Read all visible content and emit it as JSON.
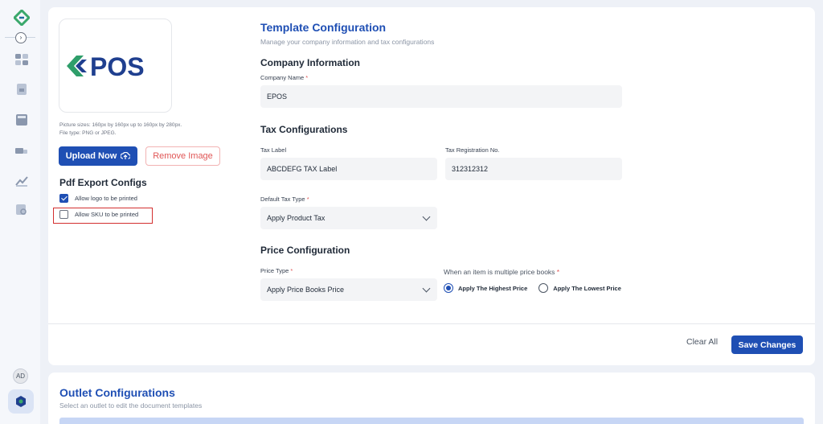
{
  "brand": {
    "logo_text": "POS",
    "accent": "#1f4fb4",
    "logo_green": "#2e9e6a"
  },
  "sidebar": {
    "avatar_initials": "AD",
    "items": [
      {
        "icon": "dashboard-icon"
      },
      {
        "icon": "document-icon"
      },
      {
        "icon": "calculator-icon"
      },
      {
        "icon": "truck-icon"
      },
      {
        "icon": "report-icon"
      },
      {
        "icon": "search-document-icon"
      }
    ],
    "settings_icon": "settings-hex-icon"
  },
  "logo_panel": {
    "hint_line1": "Picture sizes: 160px by 160px up to 160px by 280px.",
    "hint_line2": "File type: PNG or JPEG.",
    "upload_label": "Upload Now",
    "remove_label": "Remove Image"
  },
  "pdf_export": {
    "title": "Pdf Export Configs",
    "options": [
      {
        "label": "Allow logo to be printed",
        "checked": true
      },
      {
        "label": "Allow SKU to be printed",
        "checked": false
      }
    ]
  },
  "template": {
    "title": "Template Configuration",
    "subtitle": "Manage your company information and tax configurations"
  },
  "company": {
    "section_title": "Company Information",
    "name_label": "Company Name",
    "name_value": "EPOS"
  },
  "tax": {
    "section_title": "Tax Configurations",
    "label_label": "Tax Label",
    "label_value": "ABCDEFG TAX Label",
    "reg_label": "Tax Registration No.",
    "reg_value": "312312312",
    "default_type_label": "Default Tax Type",
    "default_type_value": "Apply Product Tax"
  },
  "price": {
    "section_title": "Price Configuration",
    "type_label": "Price Type",
    "type_value": "Apply Price Books Price",
    "multi_label": "When an item is multiple price books",
    "options": [
      {
        "label": "Apply The Highest Price",
        "selected": true
      },
      {
        "label": "Apply The Lowest Price",
        "selected": false
      }
    ]
  },
  "actions": {
    "clear_label": "Clear All",
    "save_label": "Save Changes"
  },
  "outlet": {
    "title": "Outlet Configurations",
    "subtitle": "Select an outlet to edit the document templates"
  },
  "required_mark": "*"
}
